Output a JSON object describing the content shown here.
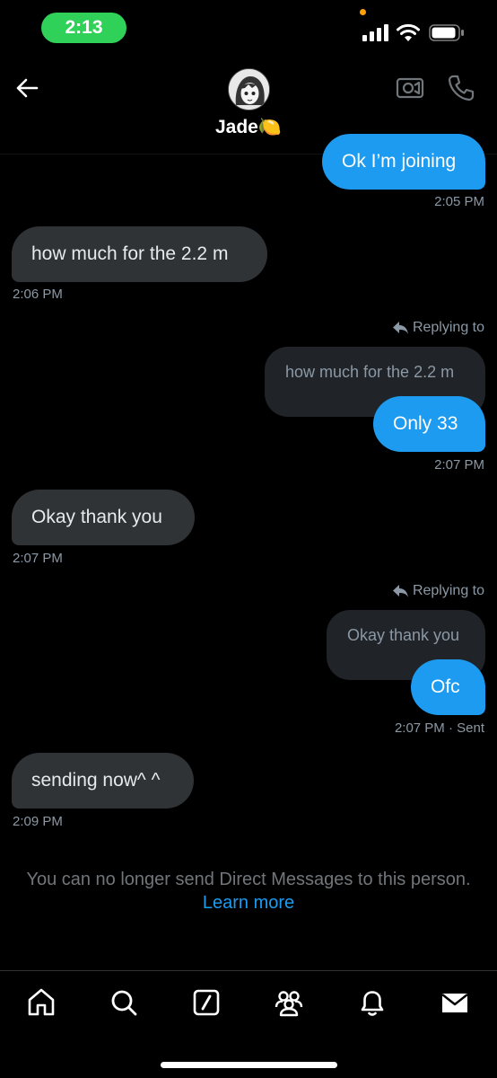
{
  "status_bar": {
    "time": "2:13",
    "colors": {
      "time_pill": "#30d158",
      "privacy_dot": "#ff9f0a"
    }
  },
  "header": {
    "contact_name": "Jade🍋",
    "icons": [
      "back-arrow-icon",
      "avatar",
      "video-call-icon",
      "phone-icon"
    ]
  },
  "messages": [
    {
      "direction": "out",
      "text": "Ok I’m joining",
      "time": "2:05 PM"
    },
    {
      "direction": "in",
      "text": "how much for the 2.2 m",
      "time": "2:06 PM"
    },
    {
      "direction": "out",
      "replying_label": "Replying to",
      "quoted": "how much for the 2.2 m",
      "text": "Only 33",
      "time": "2:07 PM"
    },
    {
      "direction": "in",
      "text": "Okay thank you",
      "time": "2:07 PM"
    },
    {
      "direction": "out",
      "replying_label": "Replying to",
      "quoted": "Okay thank you",
      "text": "Ofc",
      "time": "2:07 PM · Sent"
    },
    {
      "direction": "in",
      "text": "sending now^ ^",
      "time": "2:09 PM"
    }
  ],
  "notice": {
    "text": "You can no longer send Direct Messages to this person.",
    "link": "Learn more"
  },
  "bottom_nav": {
    "items": [
      "home-icon",
      "search-icon",
      "grok-icon",
      "communities-icon",
      "notifications-icon",
      "messages-icon"
    ]
  },
  "colors": {
    "background": "#000000",
    "incoming_bubble": "#2f3336",
    "outgoing_bubble": "#1d9bf0",
    "quoted_bubble": "#202327",
    "secondary_text": "#8b98a5",
    "link": "#1d9bf0"
  }
}
